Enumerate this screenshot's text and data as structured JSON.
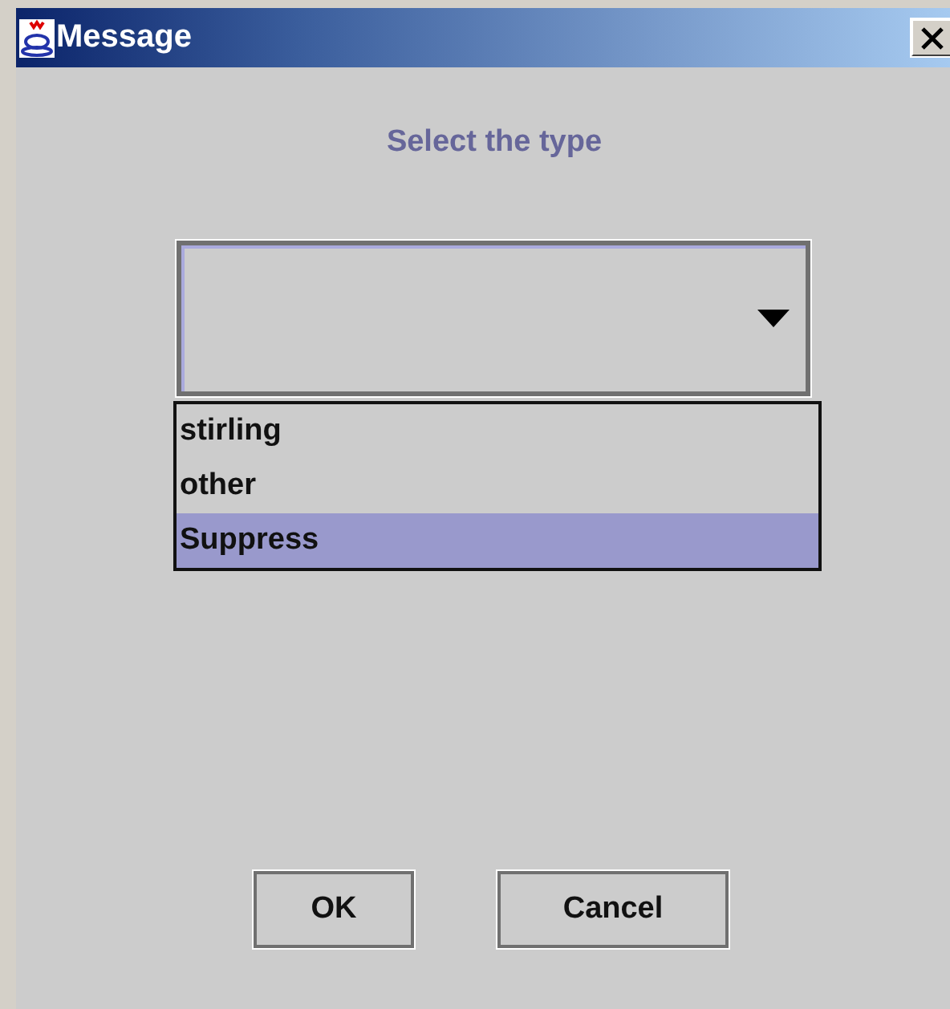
{
  "window": {
    "title": "Message"
  },
  "prompt": "Select the type",
  "dropdown": {
    "expanded": true,
    "options": [
      {
        "label": "stirling",
        "selected": false
      },
      {
        "label": "other",
        "selected": false
      },
      {
        "label": "Suppress",
        "selected": true
      }
    ]
  },
  "buttons": [
    "OK",
    "Cancel"
  ]
}
